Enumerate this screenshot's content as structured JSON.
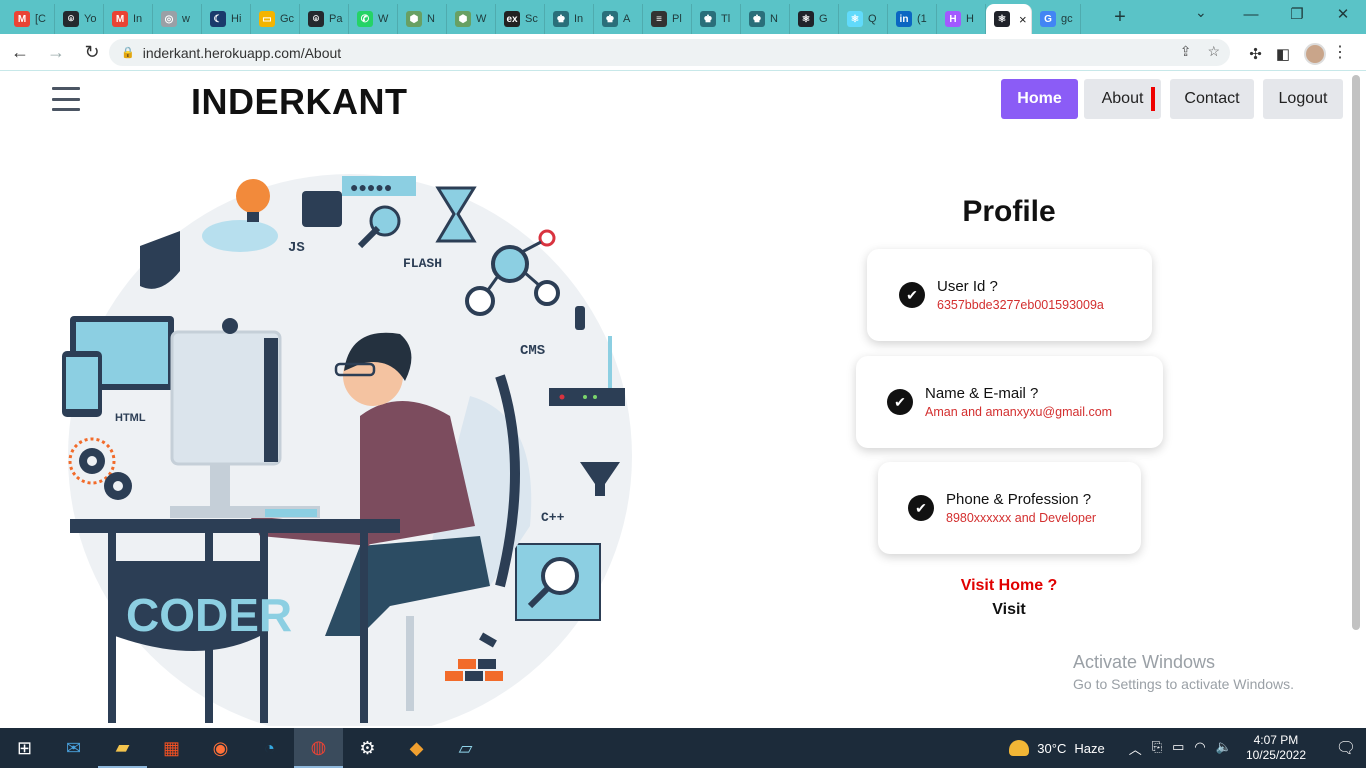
{
  "browser": {
    "tabs": [
      {
        "label": "[C",
        "fav": "M",
        "color": "#ea4335"
      },
      {
        "label": "Yo",
        "fav": "⌾",
        "color": "#24292e"
      },
      {
        "label": "In",
        "fav": "M",
        "color": "#ea4335"
      },
      {
        "label": "w",
        "fav": "◎",
        "color": "#9aa0a6"
      },
      {
        "label": "Hi",
        "fav": "☾",
        "color": "#1a3a6b"
      },
      {
        "label": "Gc",
        "fav": "▭",
        "color": "#f4b400"
      },
      {
        "label": "Pa",
        "fav": "⌾",
        "color": "#24292e"
      },
      {
        "label": "W",
        "fav": "✆",
        "color": "#25d366"
      },
      {
        "label": "N",
        "fav": "⬢",
        "color": "#68a063"
      },
      {
        "label": "W",
        "fav": "⬢",
        "color": "#68a063"
      },
      {
        "label": "Sc",
        "fav": "ex",
        "color": "#222222"
      },
      {
        "label": "In",
        "fav": "♚",
        "color": "#2a6f7a"
      },
      {
        "label": "A",
        "fav": "♚",
        "color": "#2a6f7a"
      },
      {
        "label": "Pl",
        "fav": "≡",
        "color": "#333333"
      },
      {
        "label": "Tl",
        "fav": "♚",
        "color": "#2a6f7a"
      },
      {
        "label": "N",
        "fav": "♚",
        "color": "#2a6f7a"
      },
      {
        "label": "G",
        "fav": "⚛",
        "color": "#20232a"
      },
      {
        "label": "Q",
        "fav": "⚛",
        "color": "#61dafb"
      },
      {
        "label": "(1",
        "fav": "in",
        "color": "#0a66c2"
      },
      {
        "label": "H",
        "fav": "H",
        "color": "#a259ff"
      },
      {
        "label": "×",
        "fav": "⚛",
        "color": "#20232a",
        "active": true
      },
      {
        "label": "gc",
        "fav": "G",
        "color": "#4285f4"
      }
    ],
    "url": "inderkant.herokuapp.com/About"
  },
  "site": {
    "brand": "INDERKANT",
    "nav": {
      "home": "Home",
      "about": "About",
      "contact": "Contact",
      "logout": "Logout"
    }
  },
  "illustration": {
    "labels": [
      "JS",
      "FLASH",
      "CMS",
      "HTML",
      "C++",
      "CODER"
    ]
  },
  "profile": {
    "title": "Profile",
    "cards": [
      {
        "label": "User Id ?",
        "value": "6357bbde3277eb001593009a"
      },
      {
        "label": "Name & E-mail ?",
        "value": "Aman and amanxyxu@gmail.com"
      },
      {
        "label": "Phone & Profession ?",
        "value": "8980xxxxxx and Developer"
      }
    ],
    "visit_question": "Visit Home ?",
    "visit_label": "Visit"
  },
  "watermark": {
    "line1": "Activate Windows",
    "line2": "Go to Settings to activate Windows."
  },
  "taskbar": {
    "weather_temp": "30°C",
    "weather_desc": "Haze",
    "time": "4:07 PM",
    "date": "10/25/2022"
  }
}
